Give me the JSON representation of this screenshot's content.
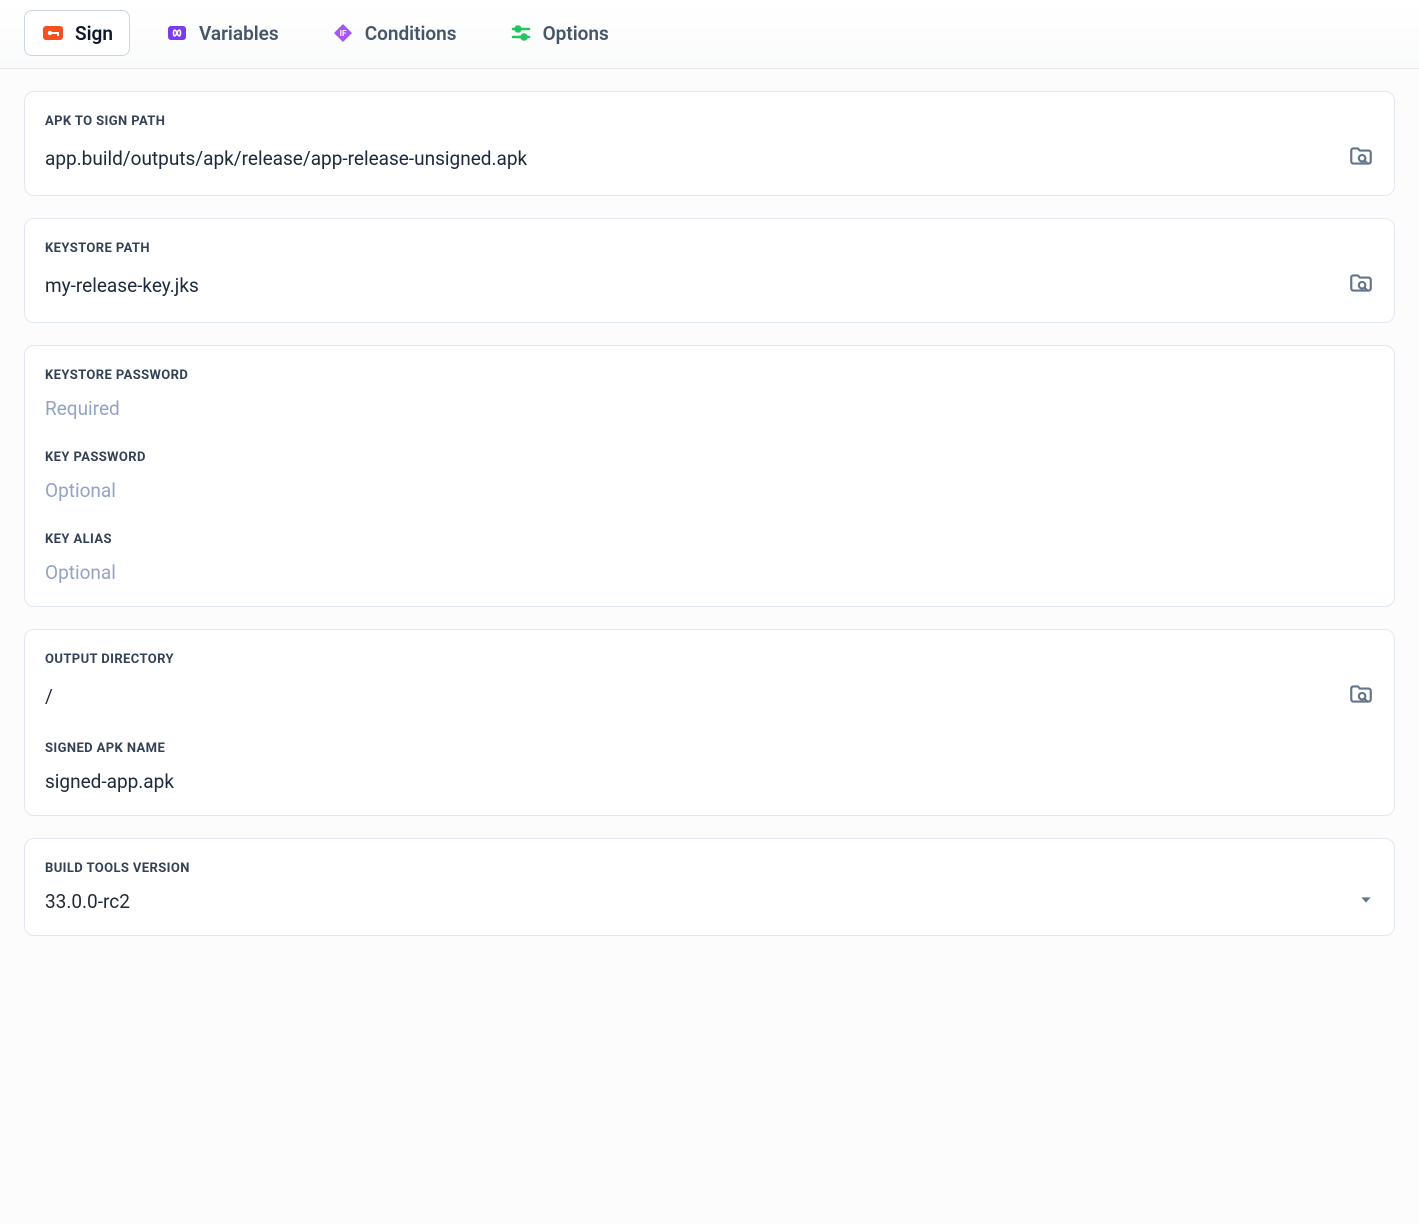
{
  "tabs": {
    "sign": "Sign",
    "variables": "Variables",
    "conditions": "Conditions",
    "options": "Options"
  },
  "fields": {
    "apk_path": {
      "label": "APK TO SIGN PATH",
      "value": "app.build/outputs/apk/release/app-release-unsigned.apk"
    },
    "keystore_path": {
      "label": "KEYSTORE PATH",
      "value": "my-release-key.jks"
    },
    "keystore_password": {
      "label": "KEYSTORE PASSWORD",
      "placeholder": "Required",
      "value": ""
    },
    "key_password": {
      "label": "KEY PASSWORD",
      "placeholder": "Optional",
      "value": ""
    },
    "key_alias": {
      "label": "KEY ALIAS",
      "placeholder": "Optional",
      "value": ""
    },
    "output_directory": {
      "label": "OUTPUT DIRECTORY",
      "value": "/"
    },
    "signed_apk_name": {
      "label": "SIGNED APK NAME",
      "value": "signed-app.apk"
    },
    "build_tools_version": {
      "label": "BUILD TOOLS VERSION",
      "value": "33.0.0-rc2"
    }
  }
}
